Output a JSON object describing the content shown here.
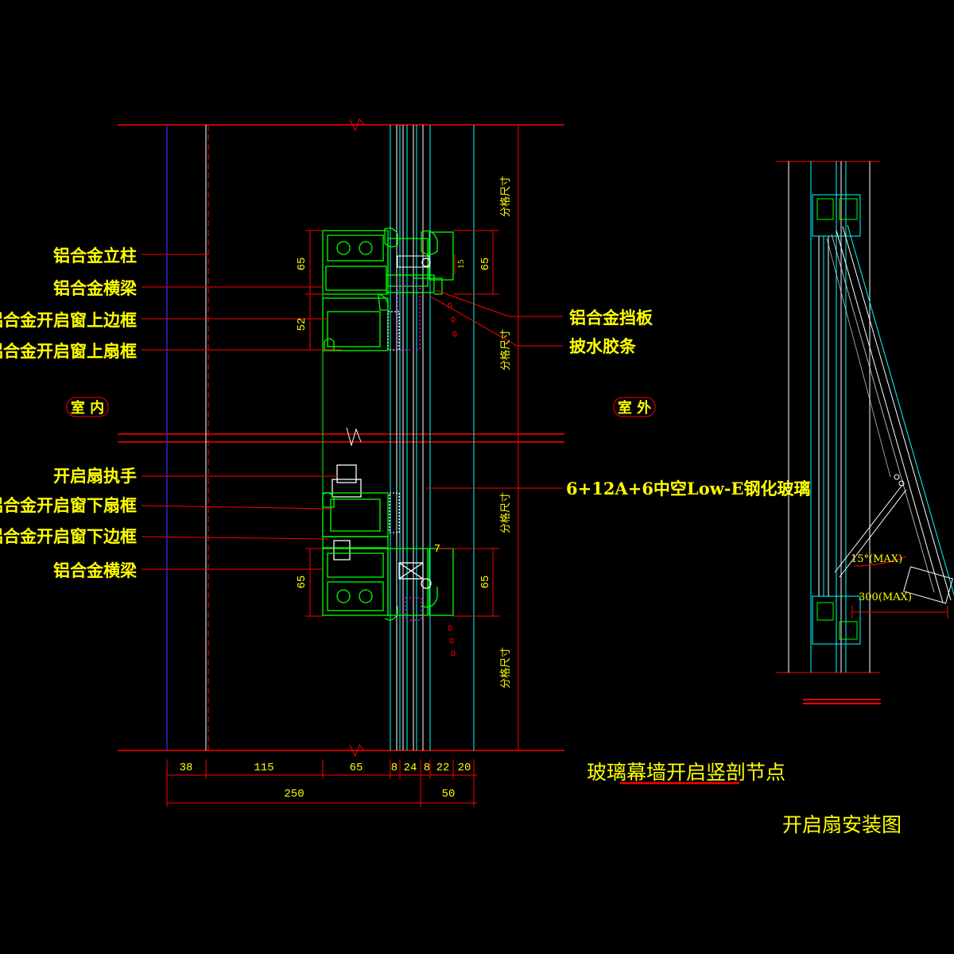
{
  "colors": {
    "background": "#000000",
    "text": "#ffff00",
    "leader": "#ff0000",
    "profile": "#00ff00",
    "glass": "#00ffff",
    "axis": "#0000ff",
    "white": "#ffffff"
  },
  "left_labels": [
    "铝合金立柱",
    "铝合金横梁",
    "铝合金开启窗上边框",
    "铝合金开启窗上扇框",
    "开启扇执手",
    "铝合金开启窗下扇框",
    "铝合金开启窗下边框",
    "铝合金横梁"
  ],
  "right_labels": [
    "铝合金挡板",
    "披水胶条",
    "6+12A+6中空Low-E钢化玻璃"
  ],
  "side_labels": {
    "interior": "室 内",
    "exterior": "室 外"
  },
  "dimensions": {
    "bottom_row": [
      "38",
      "115",
      "65",
      "8",
      "24",
      "8",
      "22",
      "20"
    ],
    "total_row": [
      "250",
      "50"
    ],
    "vertical_left": [
      "65",
      "52",
      "65"
    ],
    "vertical_right": [
      "65",
      "65"
    ],
    "small_marks": [
      "15",
      "7"
    ],
    "module_label": "分格尺寸"
  },
  "titles": {
    "main": "玻璃幕墙开启竖剖节点",
    "install": "开启扇安装图"
  },
  "install_notes": {
    "angle": "15°(MAX)",
    "opening": "300(MAX)"
  }
}
